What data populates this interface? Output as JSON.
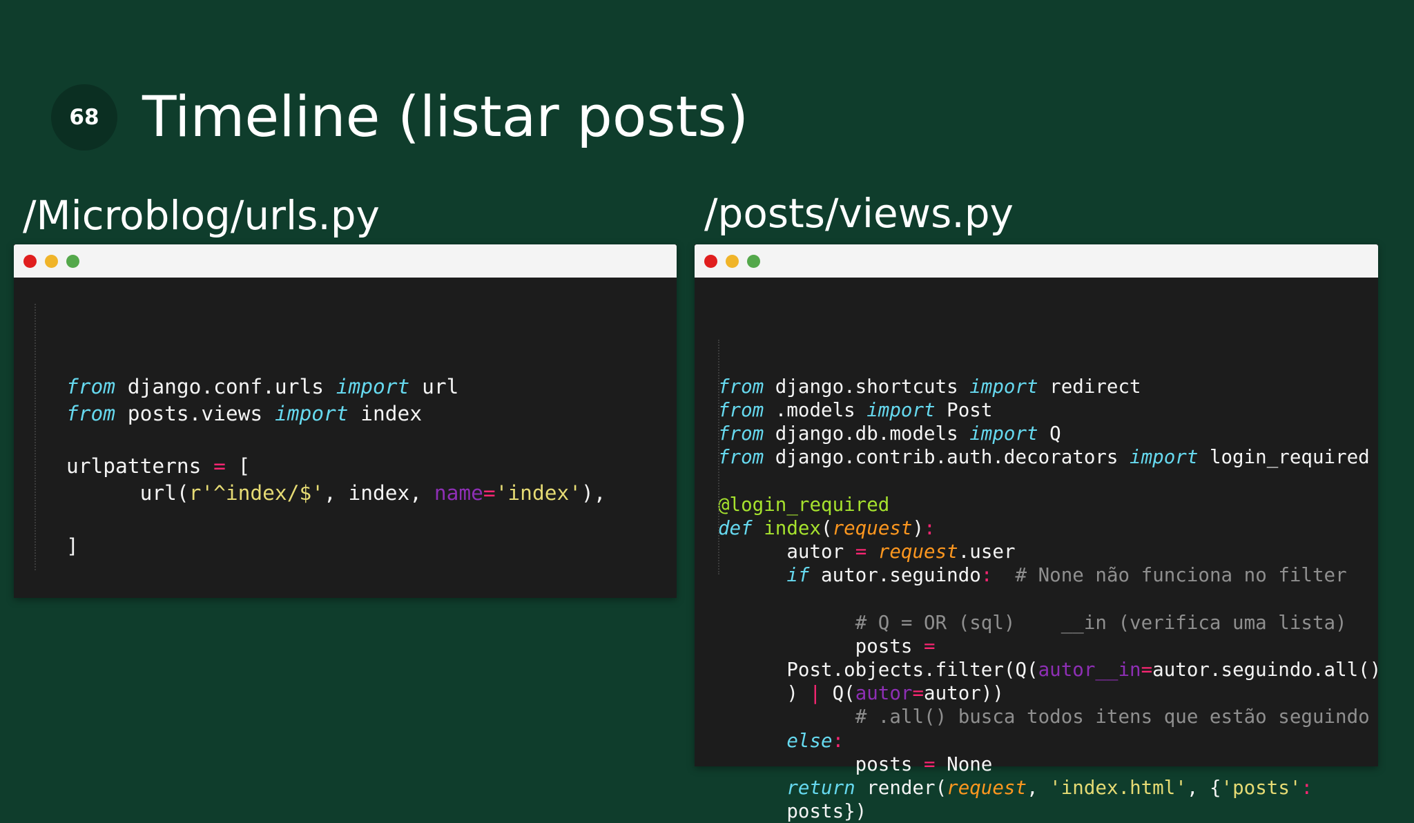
{
  "slide": {
    "number": "68",
    "title": "Timeline (listar posts)"
  },
  "left_panel": {
    "file_path": "/Microblog/urls.py",
    "window_dots": [
      "red",
      "yellow",
      "green"
    ],
    "code_lines": [
      [
        [
          "kw",
          "from"
        ],
        [
          "txt",
          " django.conf.urls "
        ],
        [
          "kw",
          "import"
        ],
        [
          "txt",
          " url"
        ]
      ],
      [
        [
          "kw",
          "from"
        ],
        [
          "txt",
          " posts.views "
        ],
        [
          "kw",
          "import"
        ],
        [
          "txt",
          " index"
        ]
      ],
      [],
      [
        [
          "txt",
          "urlpatterns "
        ],
        [
          "op",
          "="
        ],
        [
          "txt",
          " ["
        ]
      ],
      [
        [
          "txt",
          "      url("
        ],
        [
          "str",
          "r'^index/$'"
        ],
        [
          "txt",
          ", index, "
        ],
        [
          "kwarg",
          "name"
        ],
        [
          "op",
          "="
        ],
        [
          "str",
          "'index'"
        ],
        [
          "txt",
          "),"
        ]
      ],
      [],
      [
        [
          "txt",
          "]"
        ]
      ]
    ]
  },
  "right_panel": {
    "file_path": "/posts/views.py",
    "window_dots": [
      "red",
      "yellow",
      "green"
    ],
    "code_lines": [
      [
        [
          "kw",
          "from"
        ],
        [
          "txt",
          " django.shortcuts "
        ],
        [
          "kw",
          "import"
        ],
        [
          "txt",
          " redirect"
        ]
      ],
      [
        [
          "kw",
          "from"
        ],
        [
          "txt",
          " .models "
        ],
        [
          "kw",
          "import"
        ],
        [
          "txt",
          " Post"
        ]
      ],
      [
        [
          "kw",
          "from"
        ],
        [
          "txt",
          " django.db.models "
        ],
        [
          "kw",
          "import"
        ],
        [
          "txt",
          " Q"
        ]
      ],
      [
        [
          "kw",
          "from"
        ],
        [
          "txt",
          " django.contrib.auth.decorators "
        ],
        [
          "kw",
          "import"
        ],
        [
          "txt",
          " login_required"
        ]
      ],
      [],
      [
        [
          "deco",
          "@login_required"
        ]
      ],
      [
        [
          "kw",
          "def"
        ],
        [
          "txt",
          " "
        ],
        [
          "fn",
          "index"
        ],
        [
          "txt",
          "("
        ],
        [
          "param",
          "request"
        ],
        [
          "txt",
          ")"
        ],
        [
          "op",
          ":"
        ]
      ],
      [
        [
          "txt",
          "      autor "
        ],
        [
          "op",
          "="
        ],
        [
          "txt",
          " "
        ],
        [
          "param",
          "request"
        ],
        [
          "txt",
          ".user"
        ]
      ],
      [
        [
          "txt",
          "      "
        ],
        [
          "kw",
          "if"
        ],
        [
          "txt",
          " autor.seguindo"
        ],
        [
          "op",
          ":"
        ],
        [
          "txt",
          "  "
        ],
        [
          "cmt",
          "# None não funciona no filter"
        ]
      ],
      [],
      [
        [
          "txt",
          "            "
        ],
        [
          "cmt",
          "# Q = OR (sql)    __in (verifica uma lista)"
        ]
      ],
      [
        [
          "txt",
          "            posts "
        ],
        [
          "op",
          "="
        ]
      ],
      [
        [
          "txt",
          "      Post.objects.filter(Q("
        ],
        [
          "kwarg",
          "autor__in"
        ],
        [
          "op",
          "="
        ],
        [
          "txt",
          "autor.seguindo.all()"
        ]
      ],
      [
        [
          "txt",
          "      ) "
        ],
        [
          "op",
          "|"
        ],
        [
          "txt",
          " Q("
        ],
        [
          "kwarg",
          "autor"
        ],
        [
          "op",
          "="
        ],
        [
          "txt",
          "autor))"
        ]
      ],
      [
        [
          "txt",
          "            "
        ],
        [
          "cmt",
          "# .all() busca todos itens que estão seguindo"
        ]
      ],
      [
        [
          "txt",
          "      "
        ],
        [
          "kw",
          "else"
        ],
        [
          "op",
          ":"
        ]
      ],
      [
        [
          "txt",
          "            posts "
        ],
        [
          "op",
          "="
        ],
        [
          "txt",
          " None"
        ]
      ],
      [
        [
          "txt",
          "      "
        ],
        [
          "kw",
          "return"
        ],
        [
          "txt",
          " render("
        ],
        [
          "param",
          "request"
        ],
        [
          "txt",
          ", "
        ],
        [
          "str",
          "'index.html'"
        ],
        [
          "txt",
          ", {"
        ],
        [
          "str",
          "'posts'"
        ],
        [
          "op",
          ":"
        ]
      ],
      [
        [
          "txt",
          "      posts})"
        ]
      ]
    ]
  }
}
